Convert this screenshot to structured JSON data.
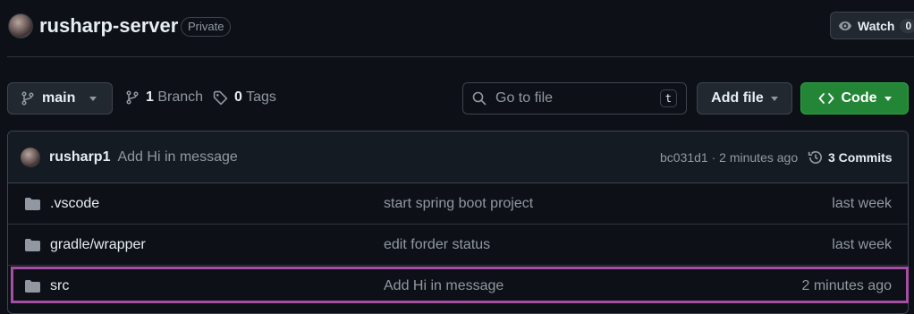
{
  "header": {
    "repo_name": "rusharp-server",
    "visibility": "Private",
    "watch_label": "Watch",
    "watch_count": "0"
  },
  "toolbar": {
    "branch": "main",
    "branch_count": "1",
    "branch_label": "Branch",
    "tag_count": "0",
    "tag_label": "Tags",
    "search_placeholder": "Go to file",
    "search_shortcut": "t",
    "add_file_label": "Add file",
    "code_label": "Code"
  },
  "commit": {
    "author": "rusharp1",
    "message": "Add Hi in message",
    "hash_time": "bc031d1 · 2 minutes ago",
    "commits_label": "3 Commits"
  },
  "files": [
    {
      "name": ".vscode",
      "message": "start spring boot project",
      "date": "last week",
      "type": "folder"
    },
    {
      "name": "gradle/wrapper",
      "message": "edit forder status",
      "date": "last week",
      "type": "folder"
    },
    {
      "name": "src",
      "message": "Add Hi in message",
      "date": "2 minutes ago",
      "type": "folder",
      "highlighted": true
    }
  ],
  "colors": {
    "background": "#0d1117",
    "accent_green": "#238636",
    "highlight": "#a54fa3",
    "muted_text": "#9198a1"
  },
  "icons": [
    "avatar",
    "eye-icon",
    "branch-icon",
    "tag-icon",
    "search-icon",
    "chevron-down-icon",
    "code-icon",
    "history-icon",
    "folder-icon"
  ]
}
